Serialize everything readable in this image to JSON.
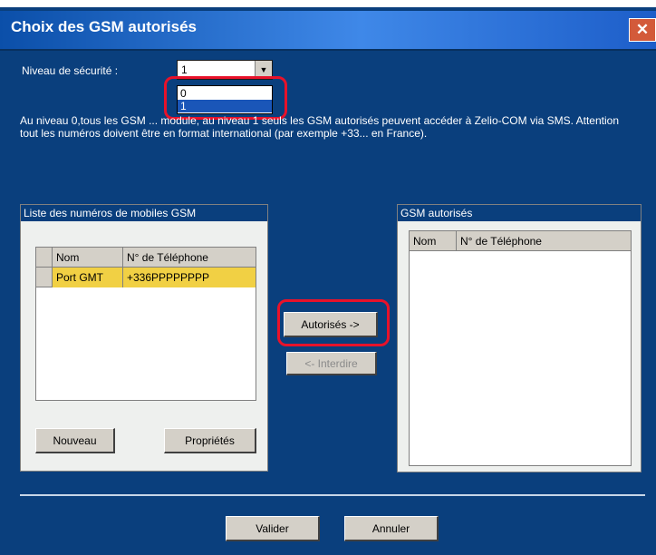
{
  "window": {
    "title": "Choix des GSM autorisés",
    "close_glyph": "✕"
  },
  "security": {
    "label": "Niveau de sécurité :",
    "selected": "1",
    "arrow_glyph": "▼",
    "options": [
      "0",
      "1"
    ],
    "highlighted_option": "1"
  },
  "notice": "Au niveau 0,tous les GSM ... module, au niveau 1 seuls les GSM autorisés peuvent accéder à Zelio-COM via SMS. Attention tout les numéros doivent être en format international (par exemple +33... en France).",
  "left_panel": {
    "title": "Liste des numéros de mobiles GSM",
    "columns": [
      "Nom",
      "N° de Téléphone"
    ],
    "rows": [
      [
        "Port GMT",
        "+336PPPPPPPP"
      ]
    ],
    "buttons": {
      "new": "Nouveau",
      "properties": "Propriétés"
    }
  },
  "middle_buttons": {
    "authorize": "Autorisés ->",
    "forbid": "<- Interdire"
  },
  "right_panel": {
    "title": "GSM autorisés",
    "columns": [
      "Nom",
      "N° de Téléphone"
    ]
  },
  "footer": {
    "validate": "Valider",
    "cancel": "Annuler"
  },
  "colors": {
    "dialog_bg": "#0a3f7d",
    "selected_row": "#f1d044",
    "highlight_outline": "#e8122a"
  }
}
